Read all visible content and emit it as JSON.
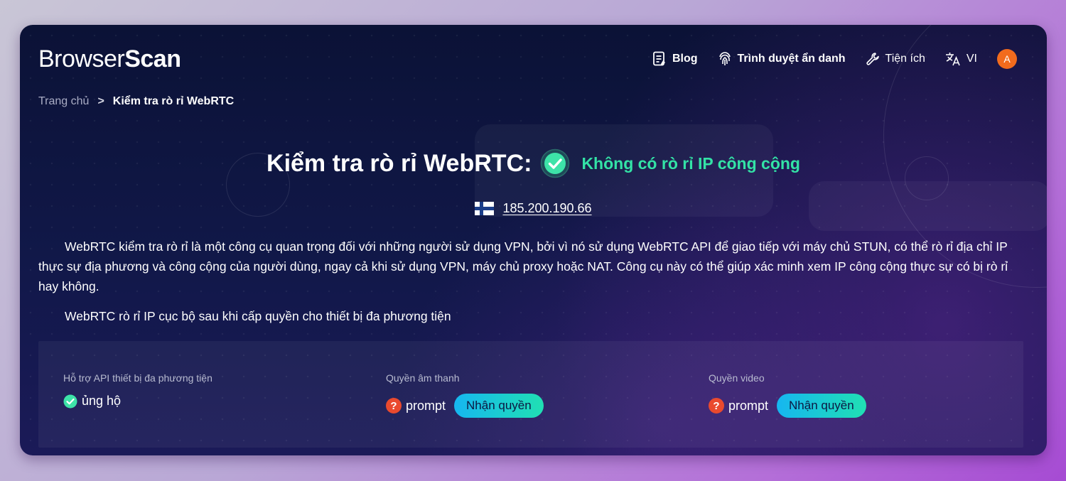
{
  "header": {
    "logo_part1": "Browser",
    "logo_part2": "Scan",
    "nav": [
      {
        "label": "Blog",
        "icon": "document-icon"
      },
      {
        "label": "Trình duyệt ẩn danh",
        "icon": "fingerprint-icon"
      },
      {
        "label": "Tiện ích",
        "icon": "wrench-icon"
      },
      {
        "label": "VI",
        "icon": "translate-icon"
      }
    ],
    "avatar_letter": "A"
  },
  "breadcrumb": {
    "home": "Trang chủ",
    "separator": ">",
    "current": "Kiểm tra rò rỉ WebRTC"
  },
  "title": {
    "main": "Kiểm tra rò rỉ WebRTC:",
    "status": "Không có rò rỉ IP công cộng",
    "status_color": "#33e3a6"
  },
  "ip": {
    "address": "185.200.190.66",
    "flag": "finland-flag"
  },
  "description": "WebRTC kiểm tra rò rỉ là một công cụ quan trọng đối với những người sử dụng VPN, bởi vì nó sử dụng WebRTC API để giao tiếp với máy chủ STUN, có thể rò rỉ địa chỉ IP thực sự địa phương và công cộng của người dùng, ngay cả khi sử dụng VPN, máy chủ proxy hoặc NAT. Công cụ này có thể giúp xác minh xem IP công cộng thực sự có bị rò rỉ hay không.",
  "subheading": "WebRTC rò rỉ IP cục bộ sau khi cấp quyền cho thiết bị đa phương tiện",
  "panel": {
    "media_support": {
      "label": "Hỗ trợ API thiết bị đa phương tiện",
      "value": "ủng hộ"
    },
    "audio": {
      "label": "Quyền âm thanh",
      "value": "prompt",
      "button": "Nhận quyền"
    },
    "video": {
      "label": "Quyền video",
      "value": "prompt",
      "button": "Nhận quyền"
    }
  },
  "colors": {
    "accent_green": "#33e3a6",
    "button_gradient_start": "#16b6f0",
    "button_gradient_end": "#20e0b3",
    "avatar_bg": "#f26b1d",
    "warning_red": "#ea4a2e"
  }
}
